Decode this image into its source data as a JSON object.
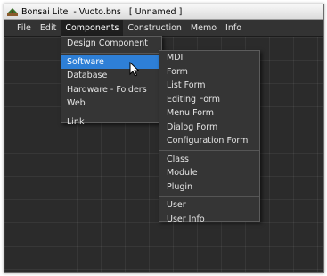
{
  "window": {
    "title": "Bonsai Lite  - Vuoto.bns   [ Unnamed ]"
  },
  "menubar": {
    "items": [
      "File",
      "Edit",
      "Components",
      "Construction",
      "Memo",
      "Info"
    ],
    "open_item": "Components"
  },
  "components_menu": {
    "items": [
      "Design Component",
      "Software",
      "Database",
      "Hardware - Folders",
      "Web",
      "Link"
    ],
    "highlighted": "Software"
  },
  "software_submenu": {
    "items": [
      "MDI",
      "Form",
      "List Form",
      "Editing Form",
      "Menu Form",
      "Dialog Form",
      "Configuration Form",
      "Class",
      "Module",
      "Plugin",
      "User",
      "User Info"
    ]
  },
  "colors": {
    "highlight": "#2e7fd6",
    "menu_bg": "#353535",
    "workspace_bg": "#2b2b2b"
  },
  "icons": {
    "app": "bonsai-tree-icon",
    "cursor": "mouse-pointer-icon"
  }
}
